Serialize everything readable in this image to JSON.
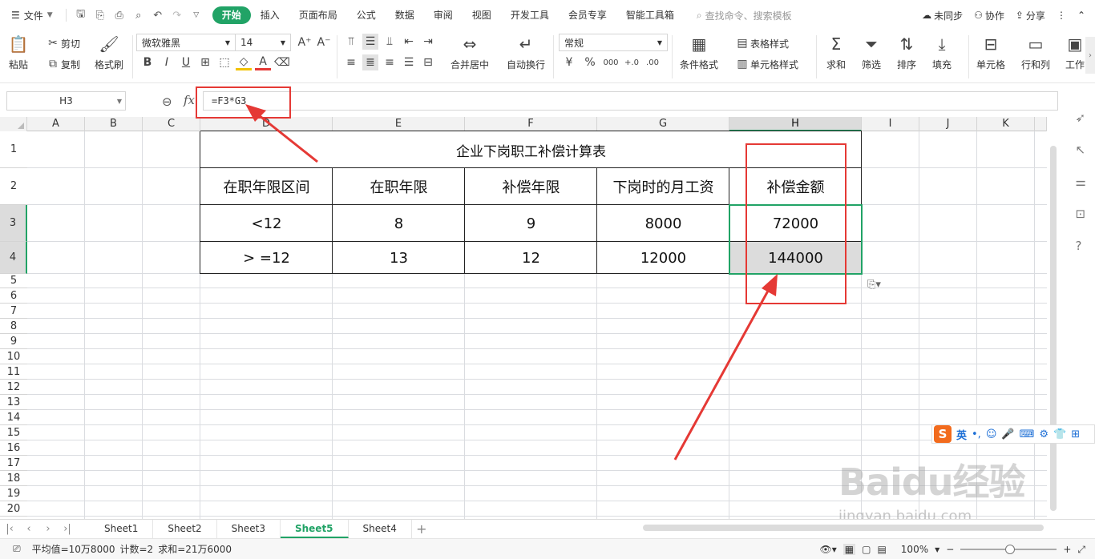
{
  "menubar": {
    "file_label": "文件",
    "tabs": [
      "开始",
      "插入",
      "页面布局",
      "公式",
      "数据",
      "审阅",
      "视图",
      "开发工具",
      "会员专享",
      "智能工具箱"
    ],
    "active_tab": "开始",
    "search_placeholder": "查找命令、搜索模板",
    "sync_label": "未同步",
    "collab_label": "协作",
    "share_label": "分享"
  },
  "ribbon": {
    "paste": "粘贴",
    "cut": "剪切",
    "copy": "复制",
    "format_painter": "格式刷",
    "font_name": "微软雅黑",
    "font_size": "14",
    "merge_center": "合并居中",
    "wrap_text": "自动换行",
    "number_format": "常规",
    "currency": "¥",
    "percent": "%",
    "thousands": "000",
    "dec_inc": "+.0",
    "dec_dec": ".00",
    "conditional_format": "条件格式",
    "table_style": "表格样式",
    "cell_style": "单元格样式",
    "sum": "求和",
    "filter": "筛选",
    "sort": "排序",
    "fill": "填充",
    "cells": "单元格",
    "row_col": "行和列",
    "worksheet": "工作"
  },
  "formula_bar": {
    "name_box": "H3",
    "fx": "fx",
    "formula": "=F3*G3"
  },
  "columns": [
    "A",
    "B",
    "C",
    "D",
    "E",
    "F",
    "G",
    "H",
    "I",
    "J",
    "K"
  ],
  "rows": [
    "1",
    "2",
    "3",
    "4",
    "5",
    "6",
    "7",
    "8",
    "9",
    "10",
    "11",
    "12",
    "13",
    "14",
    "15",
    "16",
    "17",
    "18",
    "19",
    "20"
  ],
  "table": {
    "title": "企业下岗职工补偿计算表",
    "headers": [
      "在职年限区间",
      "在职年限",
      "补偿年限",
      "下岗时的月工资",
      "补偿金额"
    ],
    "rows": [
      [
        "<12",
        "8",
        "9",
        "8000",
        "72000"
      ],
      [
        "> =12",
        "13",
        "12",
        "12000",
        "144000"
      ]
    ]
  },
  "sheets": [
    "Sheet1",
    "Sheet2",
    "Sheet3",
    "Sheet5",
    "Sheet4"
  ],
  "active_sheet": "Sheet5",
  "status": {
    "average": "平均值=10万8000",
    "count": "计数=2",
    "sum": "求和=21万6000",
    "zoom": "100%"
  },
  "ime": {
    "lang": "英"
  },
  "watermark": {
    "brand": "Baidu经验",
    "url": "jingyan.baidu.com"
  },
  "colors": {
    "accent_green": "#21a366",
    "annotation_red": "#e53935"
  }
}
